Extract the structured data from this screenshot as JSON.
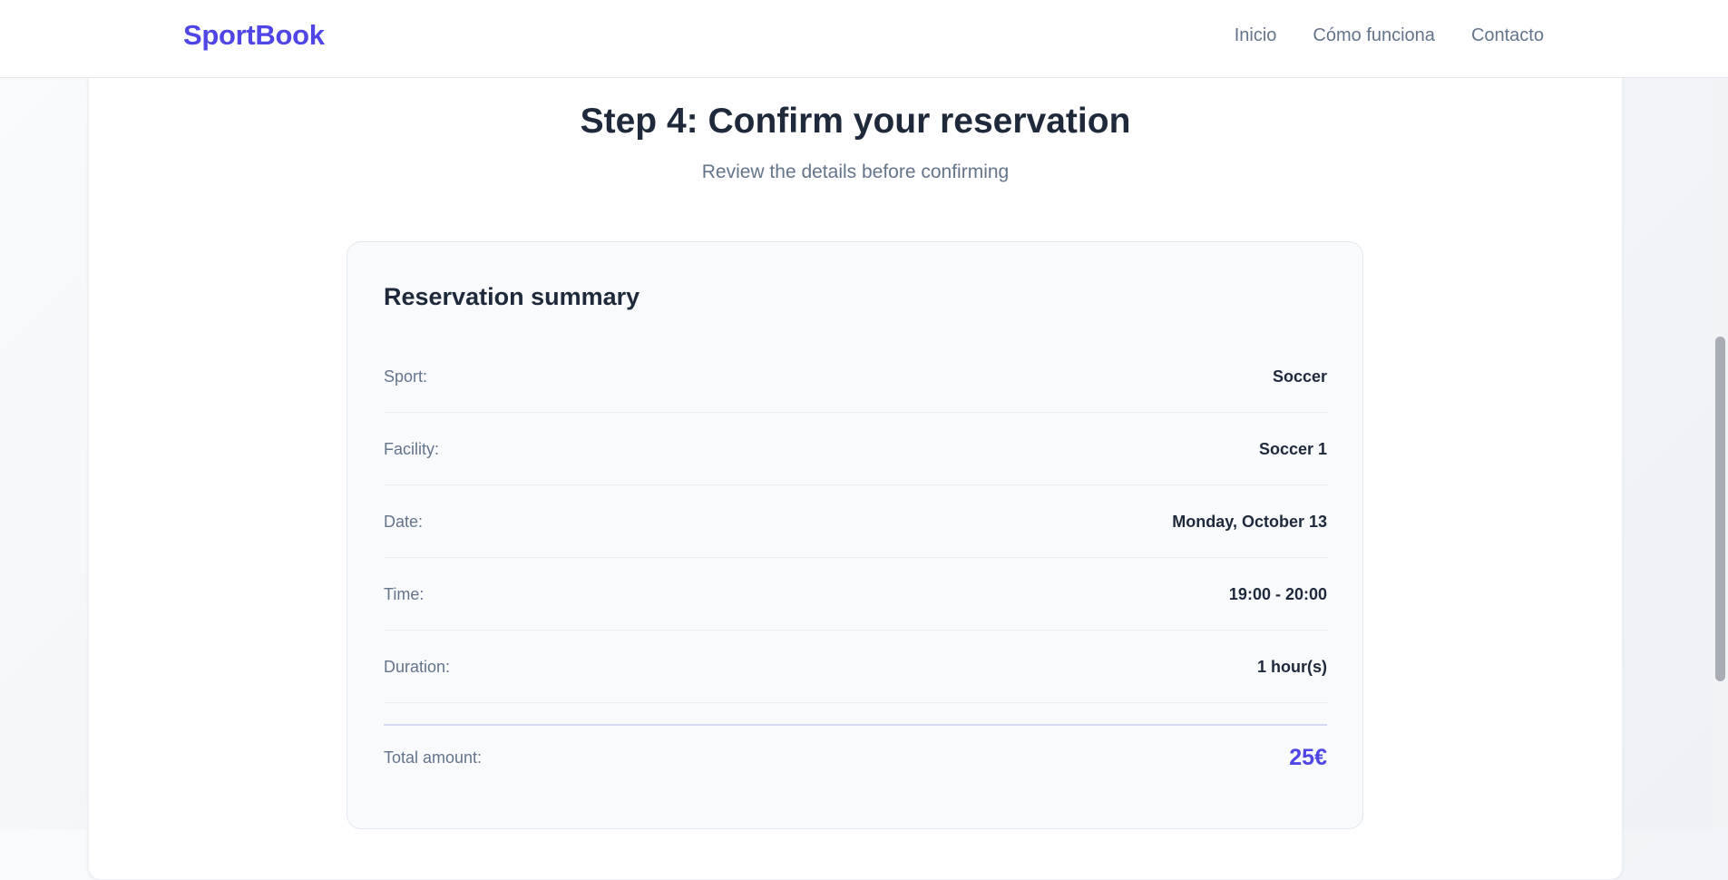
{
  "header": {
    "brand": "SportBook",
    "nav": [
      {
        "label": "Inicio"
      },
      {
        "label": "Cómo funciona"
      },
      {
        "label": "Contacto"
      }
    ]
  },
  "step": {
    "title": "Step 4: Confirm your reservation",
    "subtitle": "Review the details before confirming"
  },
  "summary": {
    "title": "Reservation summary",
    "rows": [
      {
        "label": "Sport:",
        "value": "Soccer"
      },
      {
        "label": "Facility:",
        "value": "Soccer 1"
      },
      {
        "label": "Date:",
        "value": "Monday, October 13"
      },
      {
        "label": "Time:",
        "value": "19:00 - 20:00"
      },
      {
        "label": "Duration:",
        "value": "1 hour(s)"
      }
    ],
    "total_label": "Total amount:",
    "total_value": "25€"
  },
  "colors": {
    "accent": "#4f46e5",
    "text": "#1e293b",
    "muted": "#64748b"
  }
}
